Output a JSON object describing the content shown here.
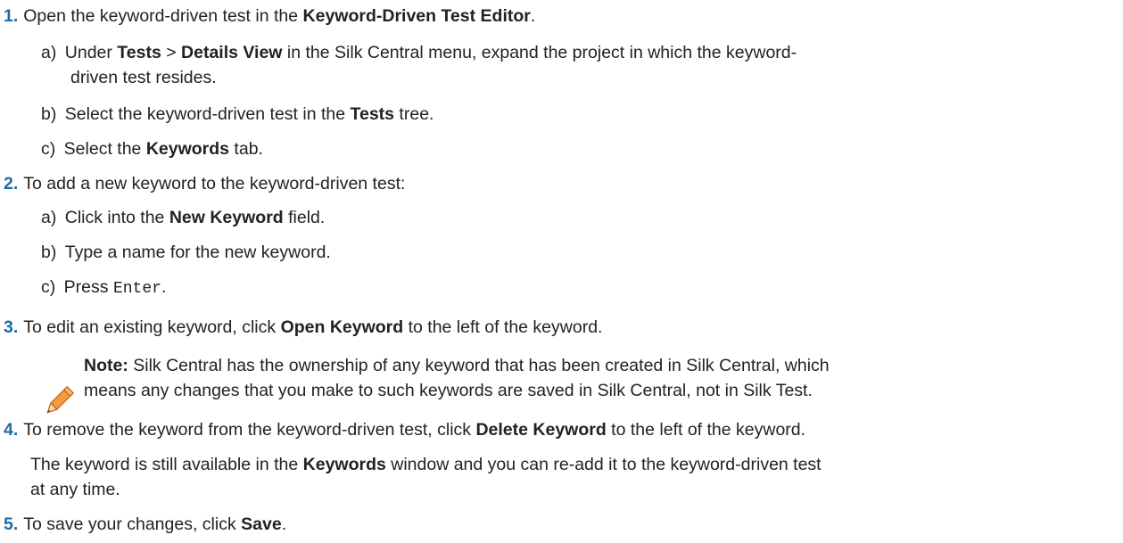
{
  "steps": [
    {
      "num": "1.",
      "parts": [
        "Open the keyword-driven test in the ",
        "Keyword-Driven Test Editor",
        "."
      ],
      "substeps": [
        {
          "label": "a)",
          "parts": [
            "Under ",
            "Tests",
            " > ",
            "Details View",
            " in the Silk Central menu, expand the project in which the keyword-"
          ],
          "cont": "driven test resides."
        },
        {
          "label": "b)",
          "parts": [
            "Select the keyword-driven test in the ",
            "Tests",
            " tree."
          ]
        },
        {
          "label": "c)",
          "parts": [
            "Select the ",
            "Keywords",
            " tab."
          ]
        }
      ]
    },
    {
      "num": "2.",
      "text": "To add a new keyword to the keyword-driven test:",
      "substeps": [
        {
          "label": "a)",
          "parts": [
            "Click into the ",
            "New Keyword",
            " field."
          ]
        },
        {
          "label": "b)",
          "text": "Type a name for the new keyword."
        },
        {
          "label": "c)",
          "pre": "Press ",
          "code": "Enter",
          "post": "."
        }
      ]
    },
    {
      "num": "3.",
      "parts": [
        "To edit an existing keyword, click ",
        "Open Keyword",
        " to the left of the keyword."
      ]
    },
    {
      "num": "4.",
      "parts": [
        "To remove the keyword from the keyword-driven test, click ",
        "Delete Keyword",
        " to the left of the keyword."
      ],
      "para_parts": [
        "The keyword is still available in the ",
        "Keywords",
        " window and you can re-add it to the keyword-driven test"
      ],
      "para_cont": "at any time."
    },
    {
      "num": "5.",
      "parts": [
        "To save your changes, click ",
        "Save",
        "."
      ]
    }
  ],
  "note": {
    "label": "Note:",
    "line1": " Silk Central has the ownership of any keyword that has been created in Silk Central, which",
    "line2": "means any changes that you make to such keywords are saved in Silk Central, not in Silk Test."
  },
  "colors": {
    "number": "#1a6ca8",
    "text": "#222222",
    "pencil": "#e8822a"
  },
  "icons": {
    "note": "pencil-icon"
  }
}
